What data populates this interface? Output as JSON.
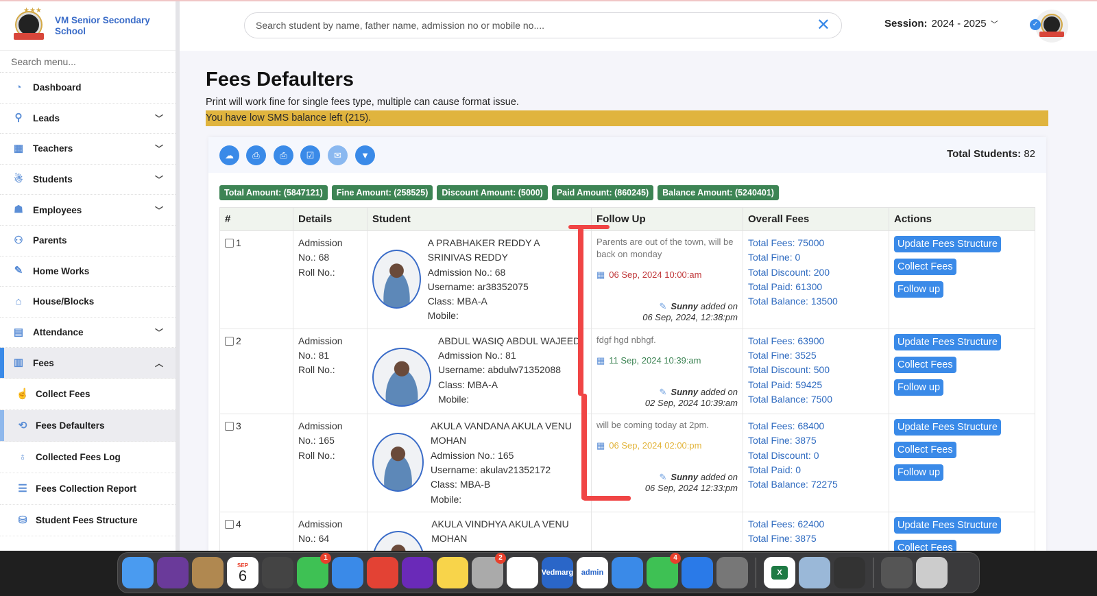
{
  "school": {
    "name": "VM Senior Secondary School"
  },
  "sidebar": {
    "search_placeholder": "Search menu...",
    "items": [
      {
        "label": "Dashboard",
        "icon": "dashboard-icon",
        "expandable": false
      },
      {
        "label": "Leads",
        "icon": "leads-icon",
        "expandable": true
      },
      {
        "label": "Teachers",
        "icon": "teachers-icon",
        "expandable": true
      },
      {
        "label": "Students",
        "icon": "students-icon",
        "expandable": true
      },
      {
        "label": "Employees",
        "icon": "employees-icon",
        "expandable": true
      },
      {
        "label": "Parents",
        "icon": "parents-icon",
        "expandable": false
      },
      {
        "label": "Home Works",
        "icon": "homework-icon",
        "expandable": false
      },
      {
        "label": "House/Blocks",
        "icon": "house-icon",
        "expandable": false
      },
      {
        "label": "Attendance",
        "icon": "calendar-icon",
        "expandable": true
      },
      {
        "label": "Fees",
        "icon": "fees-icon",
        "expandable": true,
        "expanded": true
      }
    ],
    "sub_items": [
      {
        "label": "Collect Fees",
        "icon": "hand-coin-icon"
      },
      {
        "label": "Fees Defaulters",
        "icon": "refresh-coin-icon",
        "active": true
      },
      {
        "label": "Collected Fees Log",
        "icon": "money-bag-icon"
      },
      {
        "label": "Fees Collection Report",
        "icon": "report-icon"
      },
      {
        "label": "Student Fees Structure",
        "icon": "structure-icon"
      }
    ]
  },
  "topbar": {
    "search_placeholder": "Search student by name, father name, admission no or mobile no....",
    "session_label": "Session:",
    "session_value": "2024 - 2025"
  },
  "page": {
    "title": "Fees Defaulters",
    "note": "Print will work fine for single fees type, multiple can cause format issue.",
    "sms_alert": "You have low SMS balance left (215).",
    "total_students_label": "Total Students:",
    "total_students_value": "82",
    "toolbar": [
      "cloud-download-icon",
      "print-icon",
      "print-text-icon",
      "checklist-icon",
      "sms-icon",
      "filter-icon"
    ],
    "summary": {
      "total": "Total Amount: (5847121)",
      "fine": "Fine Amount: (258525)",
      "discount": "Discount Amount: (5000)",
      "paid": "Paid Amount: (860245)",
      "balance": "Balance Amount: (5240401)"
    },
    "columns": [
      "#",
      "Details",
      "Student",
      "Follow Up",
      "Overall Fees",
      "Actions"
    ],
    "action_labels": {
      "update": "Update Fees Structure",
      "collect": "Collect Fees",
      "follow": "Follow up"
    },
    "rows": [
      {
        "num": "1",
        "admission_label": "Admission",
        "admission_no": "No.: 68",
        "roll": "Roll No.:",
        "name": "A PRABHAKER REDDY A SRINIVAS REDDY",
        "adm": "Admission No.: 68",
        "username": "Username: ar38352075",
        "class": "Class: MBA-A",
        "mobile": "Mobile:",
        "fu_note": "Parents are out of the town, will be back on monday",
        "fu_date": "06 Sep, 2024 10:00:am",
        "fu_color": "#c0393b",
        "fu_by": "Sunny",
        "fu_added": "added on",
        "fu_at": "06 Sep, 2024, 12:38:pm",
        "fees": [
          "Total Fees: 75000",
          "Total Fine: 0",
          "Total Discount: 200",
          "Total Paid: 61300",
          "Total Balance: 13500"
        ]
      },
      {
        "num": "2",
        "admission_label": "Admission",
        "admission_no": "No.: 81",
        "roll": "Roll No.:",
        "name": "ABDUL WASIQ ABDUL WAJEED",
        "adm": "Admission No.: 81",
        "username": "Username: abdulw71352088",
        "class": "Class: MBA-A",
        "mobile": "Mobile:",
        "fu_note": "fdgf hgd nbhgf.",
        "fu_date": "11 Sep, 2024 10:39:am",
        "fu_color": "#3d8454",
        "fu_by": "Sunny",
        "fu_added": "added on",
        "fu_at": "02 Sep, 2024 10:39:am",
        "fees": [
          "Total Fees: 63900",
          "Total Fine: 3525",
          "Total Discount: 500",
          "Total Paid: 59425",
          "Total Balance: 7500"
        ]
      },
      {
        "num": "3",
        "admission_label": "Admission",
        "admission_no": "No.: 165",
        "roll": "Roll No.:",
        "name": "AKULA VANDANA AKULA VENU MOHAN",
        "adm": "Admission No.: 165",
        "username": "Username: akulav21352172",
        "class": "Class: MBA-B",
        "mobile": "Mobile:",
        "fu_note": "will be coming today at 2pm.",
        "fu_date": "06 Sep, 2024 02:00:pm",
        "fu_color": "#e2b43a",
        "fu_by": "Sunny",
        "fu_added": "added on",
        "fu_at": "06 Sep, 2024 12:33:pm",
        "fees": [
          "Total Fees: 68400",
          "Total Fine: 3875",
          "Total Discount: 0",
          "Total Paid: 0",
          "Total Balance: 72275"
        ]
      },
      {
        "num": "4",
        "admission_label": "Admission",
        "admission_no": "No.: 64",
        "roll": "",
        "name": "AKULA VINDHYA AKULA VENU MOHAN",
        "fees": [
          "Total Fees: 62400",
          "Total Fine: 3875"
        ]
      }
    ]
  },
  "dock": {
    "apps": [
      {
        "name": "Finder",
        "color": "#4a9bf0"
      },
      {
        "name": "Siri",
        "color": "#6a3a9a"
      },
      {
        "name": "Contacts",
        "color": "#b08850"
      },
      {
        "name": "Calendar",
        "color": "#ffffff",
        "month": "SEP",
        "day": "6"
      },
      {
        "name": "Sublime",
        "color": "#444444"
      },
      {
        "name": "WhatsApp",
        "color": "#3ec154",
        "badge": "1"
      },
      {
        "name": "Mail",
        "color": "#3a8ae8"
      },
      {
        "name": "AnyDesk",
        "color": "#e34234"
      },
      {
        "name": "Firefox",
        "color": "#6a2ab8"
      },
      {
        "name": "Notes",
        "color": "#f8d44a"
      },
      {
        "name": "WhatsApp Beta",
        "color": "#aaaaaa",
        "badge": "2"
      },
      {
        "name": "Chrome",
        "color": "#ffffff"
      },
      {
        "name": "Vedmarg",
        "color": "#2a66c8",
        "text": "Vedmarg"
      },
      {
        "name": "Vedmarg admin",
        "color": "#ffffff",
        "text": "admin"
      },
      {
        "name": "Safari",
        "color": "#3a8ae8"
      },
      {
        "name": "FaceTime",
        "color": "#3ec154",
        "badge": "4"
      },
      {
        "name": "App Store",
        "color": "#2a7ae8"
      },
      {
        "name": "System Settings",
        "color": "#777777"
      },
      {
        "name": "Excel",
        "color": "#ffffff",
        "text": "X"
      },
      {
        "name": "Preview",
        "color": "#9ab8d8"
      },
      {
        "name": "Image Capture",
        "color": "#333333"
      },
      {
        "name": "Downloads",
        "color": "#555555"
      },
      {
        "name": "Trash",
        "color": "#cccccc"
      }
    ]
  }
}
